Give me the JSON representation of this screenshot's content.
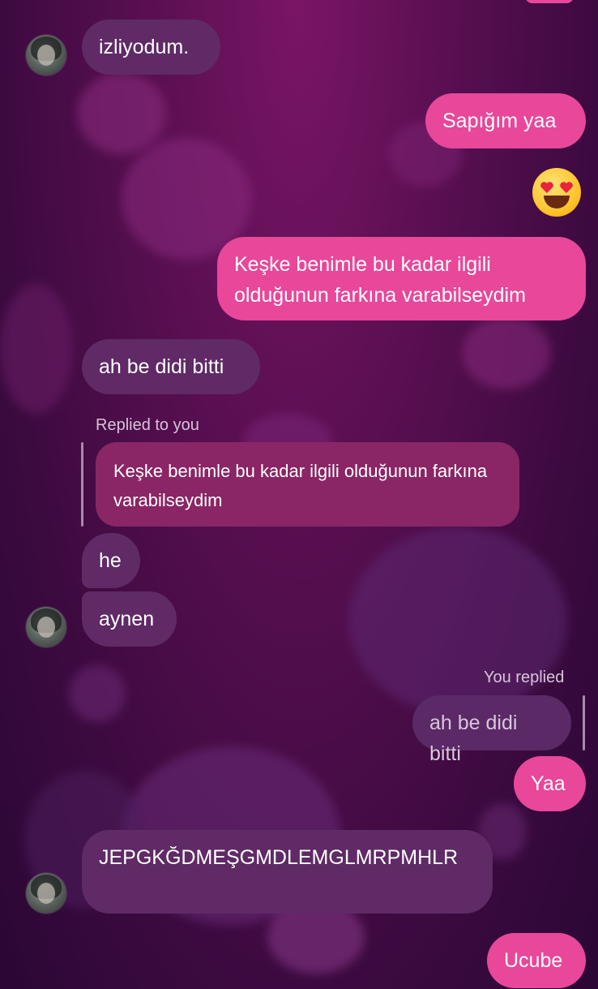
{
  "messages": {
    "m1": "izliyodum.",
    "m2": "Sapığım yaa",
    "m3": "Keşke benimle bu kadar ilgili olduğunun farkına varabilseydim",
    "m4": "ah be didi bitti",
    "m5": "he",
    "m6": "aynen",
    "m7": "Yaa",
    "m8": "JEPGKĞDMEŞGMDLEMGLMRPMHLR",
    "m9": "Ucube"
  },
  "replies": {
    "incoming_label": "Replied to you",
    "incoming_quote": "Keşke benimle bu kadar ilgili olduğunun farkına varabilseydim",
    "outgoing_label": "You replied",
    "outgoing_quote": "ah be didi bitti"
  },
  "reaction_emoji": "heart-eyes-emoji",
  "colors": {
    "outgoing_bubble": "#e8479a",
    "incoming_bubble": "#5f2a66",
    "reply_quote_in": "#8a2665"
  }
}
